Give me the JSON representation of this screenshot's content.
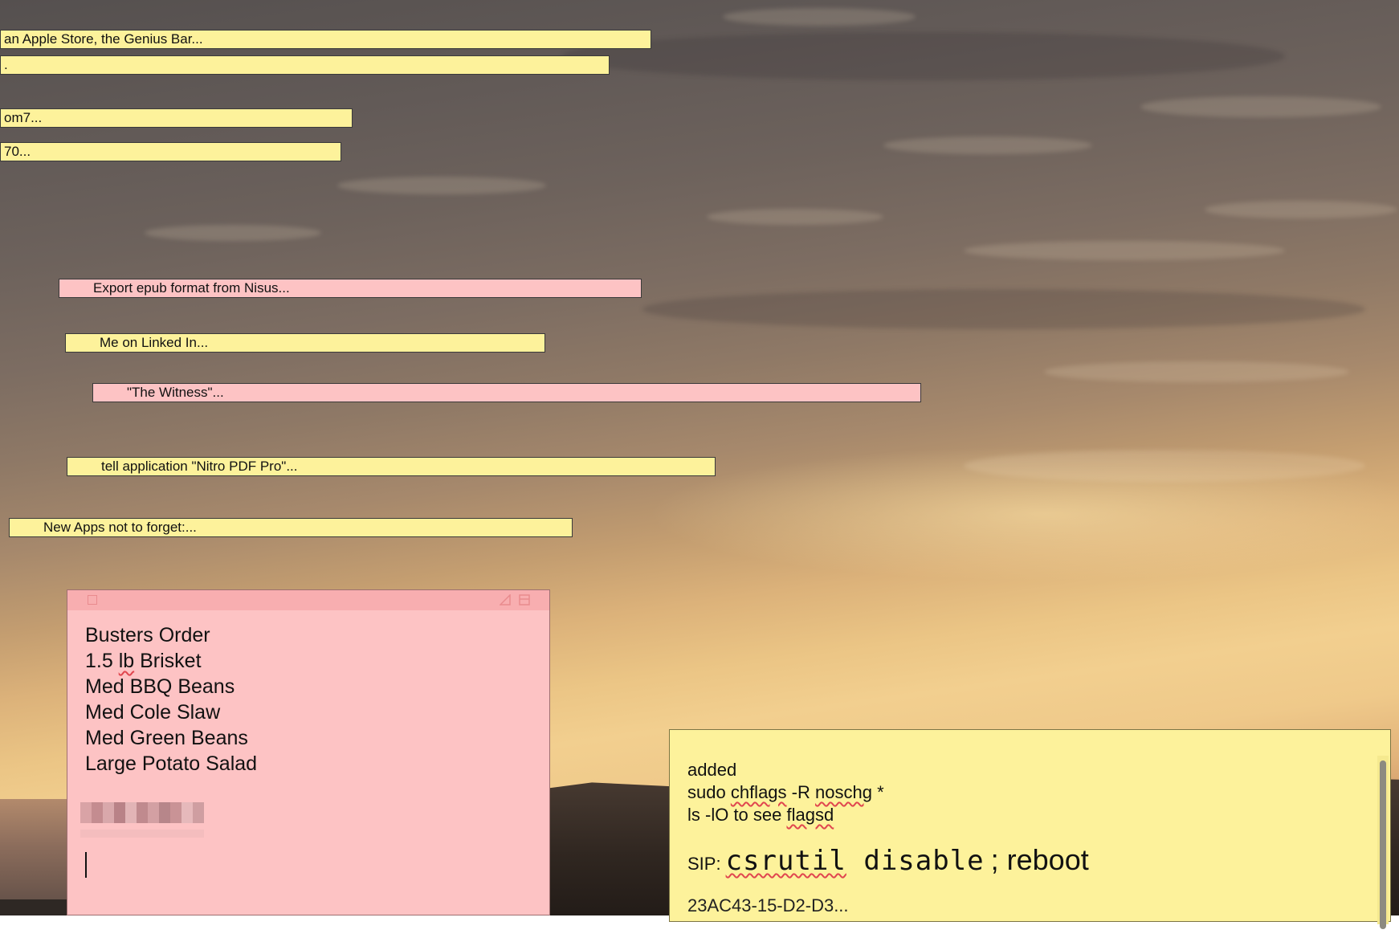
{
  "collapsed_notes": [
    {
      "text": " an Apple Store, the Genius Bar..."
    },
    {
      "text": "."
    },
    {
      "text": "om7..."
    },
    {
      "text": "70..."
    },
    {
      "text": "Export epub format from Nisus..."
    },
    {
      "text": "Me on Linked In..."
    },
    {
      "text": "\"The Witness\"..."
    },
    {
      "text": "tell application \"Nitro PDF Pro\"..."
    },
    {
      "text": "New Apps not to forget:..."
    }
  ],
  "pink_note": {
    "lines": [
      "Busters Order",
      "1.5 lb Brisket",
      "Med BBQ Beans",
      "Med Cole Slaw",
      "Med Green Beans",
      "Large Potato Salad"
    ]
  },
  "yellow_note": {
    "line1": "added",
    "line2_cmd": "sudo ",
    "line2_word": "chflags",
    "line2_mid": " -R ",
    "line2_word2": "noschg",
    "line2_end": " *",
    "line3_start": "ls -lO to see ",
    "line3_word": "flagsd",
    "sip_label": "SIP:",
    "sip_cmd_word": "csrutil",
    "sip_cmd_rest": " disable",
    "sip_end": "; reboot",
    "cut_line": "23AC43-15-D2-D3..."
  },
  "colors": {
    "yellow_note": "#fdf29b",
    "pink_note": "#fdc3c4",
    "pink_titlebar": "#f8aeb0",
    "spell_underline": "#e0464f"
  },
  "icons": {
    "close": "close-box-icon",
    "resize": "resize-triangle-icon",
    "collapse": "collapse-icon"
  }
}
